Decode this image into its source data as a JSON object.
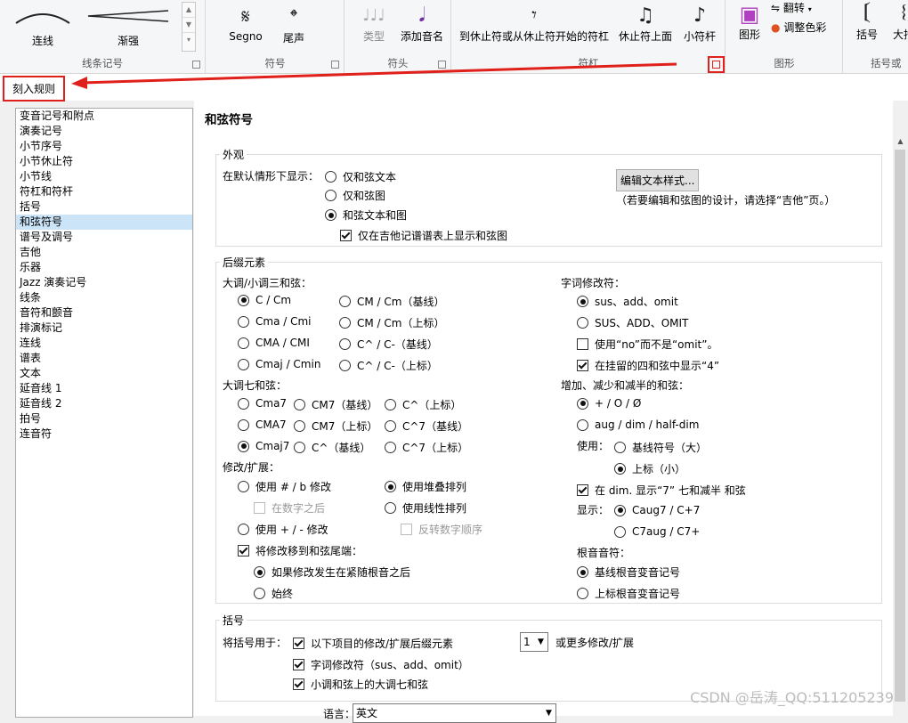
{
  "ribbon": {
    "groups": [
      {
        "label": "线条记号",
        "buttons": [
          "连线",
          "渐强"
        ]
      },
      {
        "label": "符号",
        "buttons": [
          "Segno",
          "尾声"
        ]
      },
      {
        "label": "符头",
        "buttons": [
          "类型",
          "添加音名"
        ]
      },
      {
        "label": "符杠",
        "buttons": [
          "到休止符或从休止符开始的符杠",
          "休止符上面",
          "小符杆"
        ]
      },
      {
        "label": "图形",
        "buttons": [
          "图形",
          "翻转",
          "调整色彩"
        ]
      },
      {
        "label": "括号或",
        "buttons": [
          "括号",
          "大括"
        ]
      }
    ]
  },
  "tab": {
    "label": "刻入规则"
  },
  "sidebar": {
    "items": [
      "变音记号和附点",
      "演奏记号",
      "小节序号",
      "小节休止符",
      "小节线",
      "符杠和符杆",
      "括号",
      "和弦符号",
      "谱号及调号",
      "吉他",
      "乐器",
      "Jazz 演奏记号",
      "线条",
      "音符和颤音",
      "排演标记",
      "连线",
      "谱表",
      "文本",
      "延音线 1",
      "延音线 2",
      "拍号",
      "连音符"
    ],
    "selected_index": 7
  },
  "page": {
    "title": "和弦符号"
  },
  "appearance": {
    "legend": "外观",
    "default_label": "在默认情形下显示：",
    "opt1": "仅和弦文本",
    "opt2": "仅和弦图",
    "opt3": "和弦文本和图",
    "guitar_only": "仅在吉他记谱谱表上显示和弦图",
    "edit_btn": "编辑文本样式...",
    "hint": "（若要编辑和弦图的设计，请选择“吉他”页。）"
  },
  "suffix": {
    "legend": "后缀元素",
    "triads_label": "大调/小调三和弦：",
    "t1": "C / Cm",
    "t2": "CM / Cm（基线）",
    "t3": "Cma / Cmi",
    "t4": "CM / Cm（上标）",
    "t5": "CMA / CMI",
    "t6": "C^ / C-（基线）",
    "t7": "Cmaj / Cmin",
    "t8": "C^ / C-（上标）",
    "maj7_label": "大调七和弦：",
    "m1": "Cma7",
    "m2": "CM7（基线）",
    "m3": "C^（上标）",
    "m4": "CMA7",
    "m5": "CM7（上标）",
    "m6": "C^7（基线）",
    "m7": "Cmaj7",
    "m8": "C^（基线）",
    "m9": "C^7（上标）",
    "mod_label": "修改/扩展：",
    "mod1": "使用 # / b 修改",
    "mod2": "使用堆叠排列",
    "mod3": "在数字之后",
    "mod4": "使用线性排列",
    "mod5": "使用 + / - 修改",
    "mod6": "反转数字顺序",
    "mod7": "将修改移到和弦尾端：",
    "mod8": "如果修改发生在紧随根音之后",
    "mod9": "始终",
    "lyric_label": "字词修改符：",
    "l1": "sus、add、omit",
    "l2": "SUS、ADD、OMIT",
    "l3": "使用“no”而不是“omit”。",
    "l4": "在挂留的四和弦中显示“4”",
    "aug_label": "增加、减少和减半的和弦：",
    "a1": "+ / O / Ø",
    "a2": "aug / dim / half-dim",
    "use_label": "使用：",
    "u1": "基线符号（大）",
    "u2": "上标（小）",
    "dim7": "在 dim. 显示“7” 七和减半 和弦",
    "show_label": "显示：",
    "s1": "Caug7 / C+7",
    "s2": "C7aug / C7+",
    "root_label": "根音音符：",
    "r1": "基线根音变音记号",
    "r2": "上标根音变音记号"
  },
  "brackets": {
    "legend": "括号",
    "use_label": "将括号用于：",
    "b1": "以下项目的修改/扩展后缀元素",
    "count_value": "1",
    "count_suffix": "或更多修改/扩展",
    "b2": "字词修改符（sus、add、omit）",
    "b3": "小调和弦上的大调七和弦"
  },
  "language": {
    "label": "语言：",
    "value": "英文"
  },
  "watermark": "CSDN @岳涛_QQ:511205239",
  "colors": {
    "highlight": "#e0201a",
    "selection": "#cce4f7"
  }
}
